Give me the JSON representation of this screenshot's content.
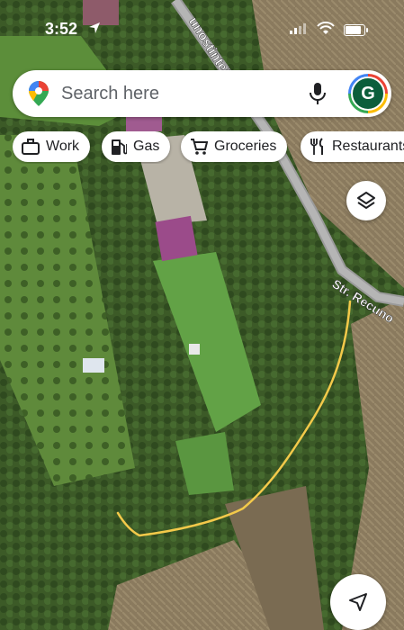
{
  "status_bar": {
    "time": "3:52"
  },
  "search": {
    "placeholder": "Search here",
    "avatar_letter": "G"
  },
  "chips": [
    {
      "label": "Work",
      "icon": "briefcase-icon"
    },
    {
      "label": "Gas",
      "icon": "gas-pump-icon"
    },
    {
      "label": "Groceries",
      "icon": "cart-icon"
    },
    {
      "label": "Restaurants",
      "icon": "fork-knife-icon"
    }
  ],
  "map": {
    "street_labels": [
      "unostintei",
      "Str. Recuno"
    ],
    "route_color": "#f3c94a",
    "view": "satellite"
  },
  "colors": {
    "accent_green": "#0b5e3b",
    "route": "#f3c94a"
  }
}
